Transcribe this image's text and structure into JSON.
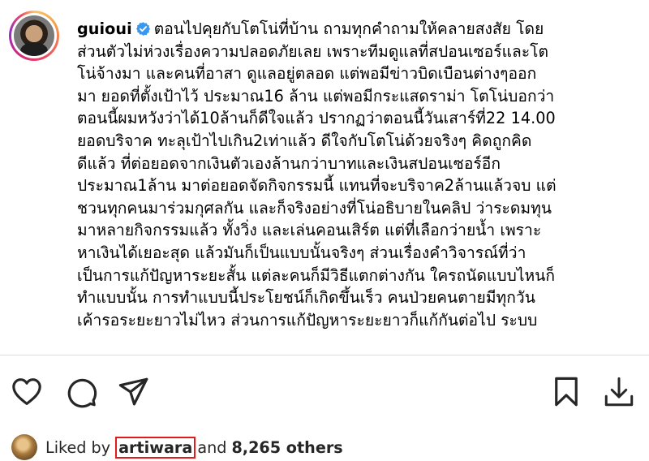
{
  "post": {
    "username": "guioui",
    "verified_icon": "verified-badge-icon",
    "caption_lines": [
      "ตอนไปคุยกับโตโน่ที่บ้าน ถามทุกคำถามให้คลายสงสัย โดย",
      "ส่วนตัวไม่ห่วงเรื่องความปลอดภัยเลย เพราะทีมดูแลที่สปอนเซอร์และโต",
      "โน่จ้างมา และคนที่อาสา ดูแลอยู่ตลอด แต่พอมีข่าวบิดเบือนต่างๆออก",
      "มา ยอดที่ตั้งเป้าไว้ ประมาณ16 ล้าน แต่พอมีกระแสดราม่า โตโน่บอกว่า",
      "ตอนนี้ผมหวังว่าได้10ล้านก็ดีใจแล้ว ปรากฏว่าตอนนี้วันเสาร์ที่22 14.00",
      "ยอดบริจาค ทะลุเป้าไปเกิน2เท่าแล้ว ดีใจกับโตโน่ด้วยจริงๆ คิดถูกคิด",
      "ดีแล้ว ที่ต่อยอดจากเงินตัวเองล้านกว่าบาทและเงินสปอนเซอร์อีก",
      "ประมาณ1ล้าน มาต่อยอดจัดกิจกรรมนี้ แทนที่จะบริจาค2ล้านแล้วจบ แต่",
      "ชวนทุกคนมาร่วมกุศลกัน และก็จริงอย่างที่โน่อธิบายในคลิป ว่าระดมทุน",
      "มาหลายกิจกรรมแล้ว ทั้งวิ่ง และเล่นคอนเสิร์ต แต่ที่เลือกว่ายน้ำ เพราะ",
      "หาเงินได้เยอะสุด แล้วมันก็เป็นแบบนั้นจริงๆ ส่วนเรื่องคำวิจารณ์ที่ว่า",
      "เป็นการแก้ปัญหาระยะสั้น แต่ละคนก็มีวิธีแตกต่างกัน ใครถนัดแบบไหนก็",
      "ทำแบบนั้น การทำแบบนี้ประโยชน์ก็เกิดขึ้นเร็ว คนป่วยคนตายมีทุกวัน",
      "เค้ารอระยะยาวไม่ไหว ส่วนการแก้ปัญหาระยะยาวก็แก้กันต่อไป ระบบ"
    ]
  },
  "actions": {
    "like": "heart-icon",
    "comment": "comment-icon",
    "share": "share-icon",
    "save": "bookmark-icon",
    "download": "download-icon"
  },
  "likes": {
    "prefix": "Liked by",
    "liker": "artiwara",
    "connector": "and",
    "count_text": "8,265 others"
  },
  "colors": {
    "verified_badge": "#3897f0",
    "highlight_border": "#e11a1a",
    "divider": "#dbdbdb"
  }
}
